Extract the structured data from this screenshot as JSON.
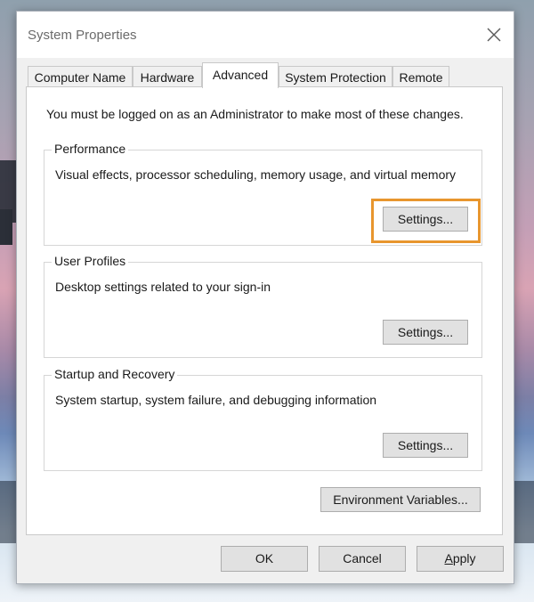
{
  "window": {
    "title": "System Properties"
  },
  "tabs": [
    {
      "label": "Computer Name",
      "active": false
    },
    {
      "label": "Hardware",
      "active": false
    },
    {
      "label": "Advanced",
      "active": true
    },
    {
      "label": "System Protection",
      "active": false
    },
    {
      "label": "Remote",
      "active": false
    }
  ],
  "advanced": {
    "admin_note": "You must be logged on as an Administrator to make most of these changes.",
    "performance": {
      "label": "Performance",
      "description": "Visual effects, processor scheduling, memory usage, and virtual memory",
      "button": "Settings..."
    },
    "user_profiles": {
      "label": "User Profiles",
      "description": "Desktop settings related to your sign-in",
      "button": "Settings..."
    },
    "startup_recovery": {
      "label": "Startup and Recovery",
      "description": "System startup, system failure, and debugging information",
      "button": "Settings..."
    },
    "env_button": "Environment Variables..."
  },
  "footer": {
    "ok": "OK",
    "cancel": "Cancel",
    "apply": "Apply"
  },
  "colors": {
    "highlight": "#e8962e",
    "window_bg": "#f0f0f0",
    "panel_bg": "#ffffff"
  },
  "icons": {
    "close": "close-icon"
  }
}
